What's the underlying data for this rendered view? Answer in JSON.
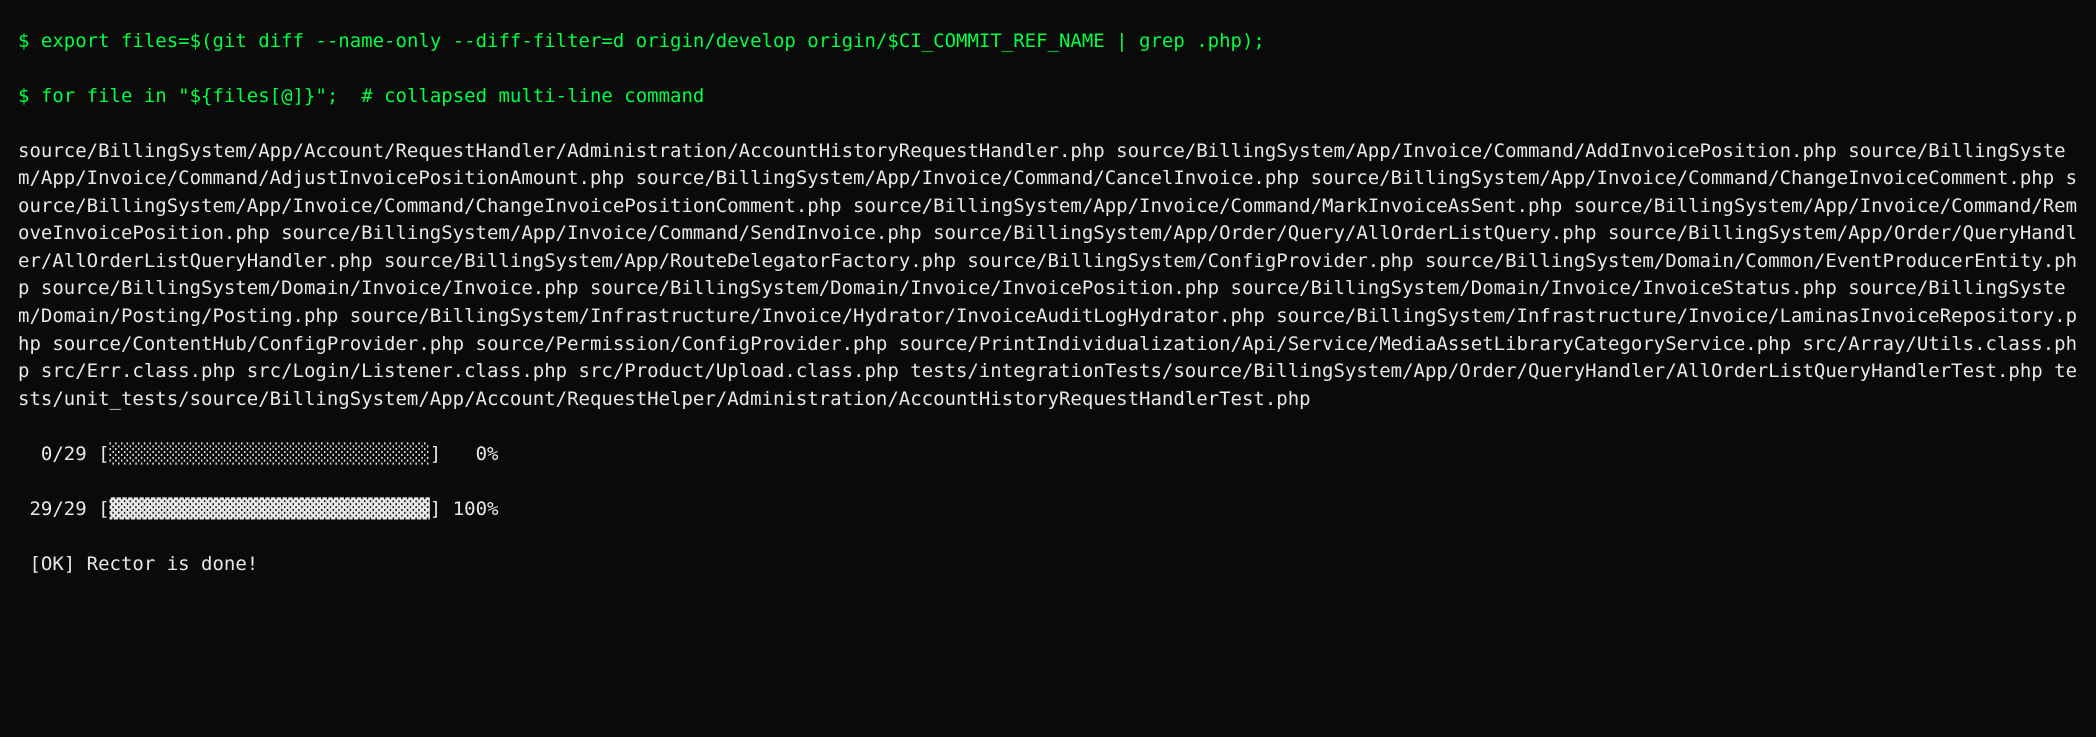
{
  "commands": {
    "prompt1": "$",
    "cmd1": " export files=$(git diff --name-only --diff-filter=d origin/develop origin/$CI_COMMIT_REF_NAME | grep .php);",
    "prompt2": "$",
    "cmd2": " for file in \"${files[@]}\";  ",
    "comment2": "# collapsed multi-line command"
  },
  "file_output": "source/BillingSystem/App/Account/RequestHandler/Administration/AccountHistoryRequestHandler.php source/BillingSystem/App/Invoice/Command/AddInvoicePosition.php source/BillingSystem/App/Invoice/Command/AdjustInvoicePositionAmount.php source/BillingSystem/App/Invoice/Command/CancelInvoice.php source/BillingSystem/App/Invoice/Command/ChangeInvoiceComment.php source/BillingSystem/App/Invoice/Command/ChangeInvoicePositionComment.php source/BillingSystem/App/Invoice/Command/MarkInvoiceAsSent.php source/BillingSystem/App/Invoice/Command/RemoveInvoicePosition.php source/BillingSystem/App/Invoice/Command/SendInvoice.php source/BillingSystem/App/Order/Query/AllOrderListQuery.php source/BillingSystem/App/Order/QueryHandler/AllOrderListQueryHandler.php source/BillingSystem/App/RouteDelegatorFactory.php source/BillingSystem/ConfigProvider.php source/BillingSystem/Domain/Common/EventProducerEntity.php source/BillingSystem/Domain/Invoice/Invoice.php source/BillingSystem/Domain/Invoice/InvoicePosition.php source/BillingSystem/Domain/Invoice/InvoiceStatus.php source/BillingSystem/Domain/Posting/Posting.php source/BillingSystem/Infrastructure/Invoice/Hydrator/InvoiceAuditLogHydrator.php source/BillingSystem/Infrastructure/Invoice/LaminasInvoiceRepository.php source/ContentHub/ConfigProvider.php source/Permission/ConfigProvider.php source/PrintIndividualization/Api/Service/MediaAssetLibraryCategoryService.php src/Array/Utils.class.php src/Err.class.php src/Login/Listener.class.php src/Product/Upload.class.php tests/integrationTests/source/BillingSystem/App/Order/QueryHandler/AllOrderListQueryHandlerTest.php tests/unit_tests/source/BillingSystem/App/Account/RequestHelper/Administration/AccountHistoryRequestHandlerTest.php",
  "progress": {
    "line1_count": "  0/29 ",
    "line1_bar": "[░░░░░░░░░░░░░░░░░░░░░░░░░░░░]",
    "line1_pct": "   0%",
    "line2_count": " 29/29 ",
    "line2_bar": "[▓▓▓▓▓▓▓▓▓▓▓▓▓▓▓▓▓▓▓▓▓▓▓▓▓▓▓▓]",
    "line2_pct": " 100%"
  },
  "status": " [OK] Rector is done!"
}
